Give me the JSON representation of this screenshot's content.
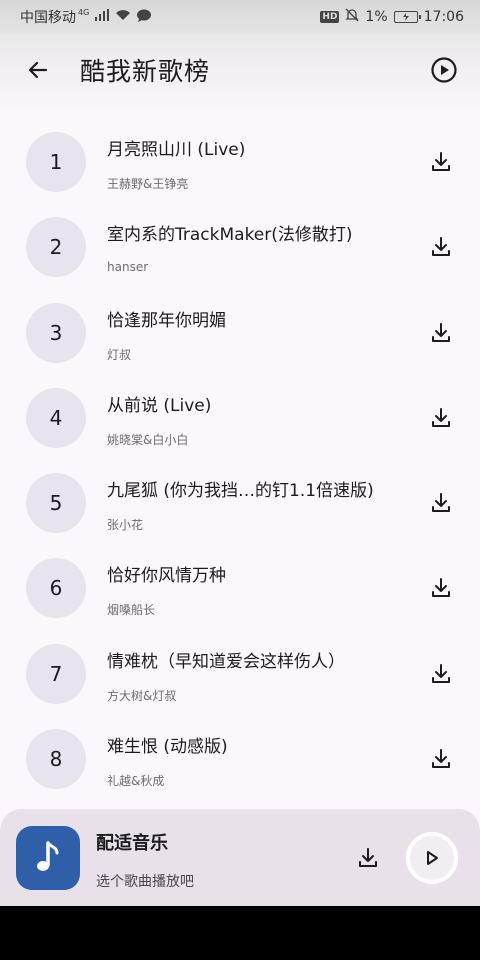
{
  "status_bar": {
    "carrier": "中国移动",
    "network": "4G",
    "hd": "HD",
    "battery_percent": "1%",
    "time": "17:06",
    "icons": [
      "signal-icon",
      "wifi-icon",
      "message-icon",
      "mute-icon",
      "battery-icon"
    ]
  },
  "header": {
    "title": "酷我新歌榜",
    "back_icon": "arrow-left-icon",
    "play_icon": "play-circle-icon"
  },
  "songs": [
    {
      "rank": "1",
      "title": "月亮照山川 (Live)",
      "artist": "王赫野&王铮亮"
    },
    {
      "rank": "2",
      "title": "室内系的TrackMaker(法修散打)",
      "artist": "hanser"
    },
    {
      "rank": "3",
      "title": "恰逢那年你明媚",
      "artist": "灯叔"
    },
    {
      "rank": "4",
      "title": "从前说 (Live)",
      "artist": "姚晓棠&白小白"
    },
    {
      "rank": "5",
      "title": "九尾狐 (你为我挡…的钉1.1倍速版)",
      "artist": "张小花"
    },
    {
      "rank": "6",
      "title": "恰好你风情万种",
      "artist": "烟嗓船长"
    },
    {
      "rank": "7",
      "title": "情难枕（早知道爱会这样伤人）",
      "artist": "方大树&灯叔"
    },
    {
      "rank": "8",
      "title": "难生恨 (动感版)",
      "artist": "礼越&秋成"
    }
  ],
  "player": {
    "title": "配适音乐",
    "subtitle": "选个歌曲播放吧",
    "art_icon": "music-note-icon"
  },
  "colors": {
    "background": "#fcf7fc",
    "rank_circle": "#e9e3ed",
    "player_bg": "#e9e1ea",
    "album_art": "#2f5fa8"
  }
}
